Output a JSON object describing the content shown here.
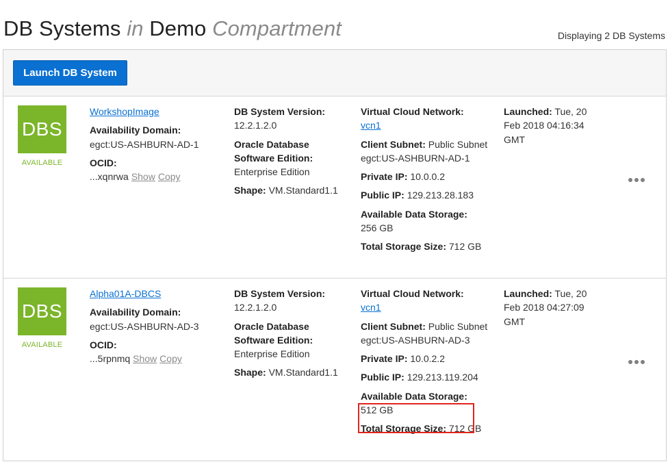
{
  "header": {
    "title_main": "DB Systems",
    "title_in": "in",
    "compartment_name": "Demo",
    "compartment_word": "Compartment",
    "display_count": "Displaying 2 DB Systems"
  },
  "toolbar": {
    "launch_label": "Launch DB System"
  },
  "labels": {
    "availability_domain": "Availability Domain:",
    "ocid": "OCID:",
    "show": "Show",
    "copy": "Copy",
    "db_system_version": "DB System Version:",
    "oracle_edition": "Oracle Database Software Edition:",
    "shape": "Shape:",
    "vcn": "Virtual Cloud Network:",
    "client_subnet": "Client Subnet:",
    "private_ip": "Private IP:",
    "public_ip": "Public IP:",
    "available_storage": "Available Data Storage:",
    "total_storage": "Total Storage Size:",
    "launched": "Launched:"
  },
  "accent_colors": {
    "primary": "#0a70d2",
    "available": "#7bb52a",
    "highlight": "#e0241b"
  },
  "rows": [
    {
      "icon_text": "DBS",
      "status": "AVAILABLE",
      "name": "WorkshopImage",
      "availability_domain": "egct:US-ASHBURN-AD-1",
      "ocid": "...xqnrwa",
      "version": "12.2.1.2.0",
      "edition": "Enterprise Edition",
      "shape": "VM.Standard1.1",
      "vcn": "vcn1",
      "client_subnet": "Public Subnet egct:US-ASHBURN-AD-1",
      "private_ip": "10.0.0.2",
      "public_ip": "129.213.28.183",
      "available_storage": "256 GB",
      "total_storage": "712 GB",
      "launched": "Tue, 20 Feb 2018 04:16:34 GMT",
      "highlighted_storage": false
    },
    {
      "icon_text": "DBS",
      "status": "AVAILABLE",
      "name": "Alpha01A-DBCS",
      "availability_domain": "egct:US-ASHBURN-AD-3",
      "ocid": "...5rpnmq",
      "version": "12.2.1.2.0",
      "edition": "Enterprise Edition",
      "shape": "VM.Standard1.1",
      "vcn": "vcn1",
      "client_subnet": "Public Subnet egct:US-ASHBURN-AD-3",
      "private_ip": "10.0.2.2",
      "public_ip": "129.213.119.204",
      "available_storage": "512 GB",
      "total_storage": "712 GB",
      "launched": "Tue, 20 Feb 2018 04:27:09 GMT",
      "highlighted_storage": true
    }
  ]
}
